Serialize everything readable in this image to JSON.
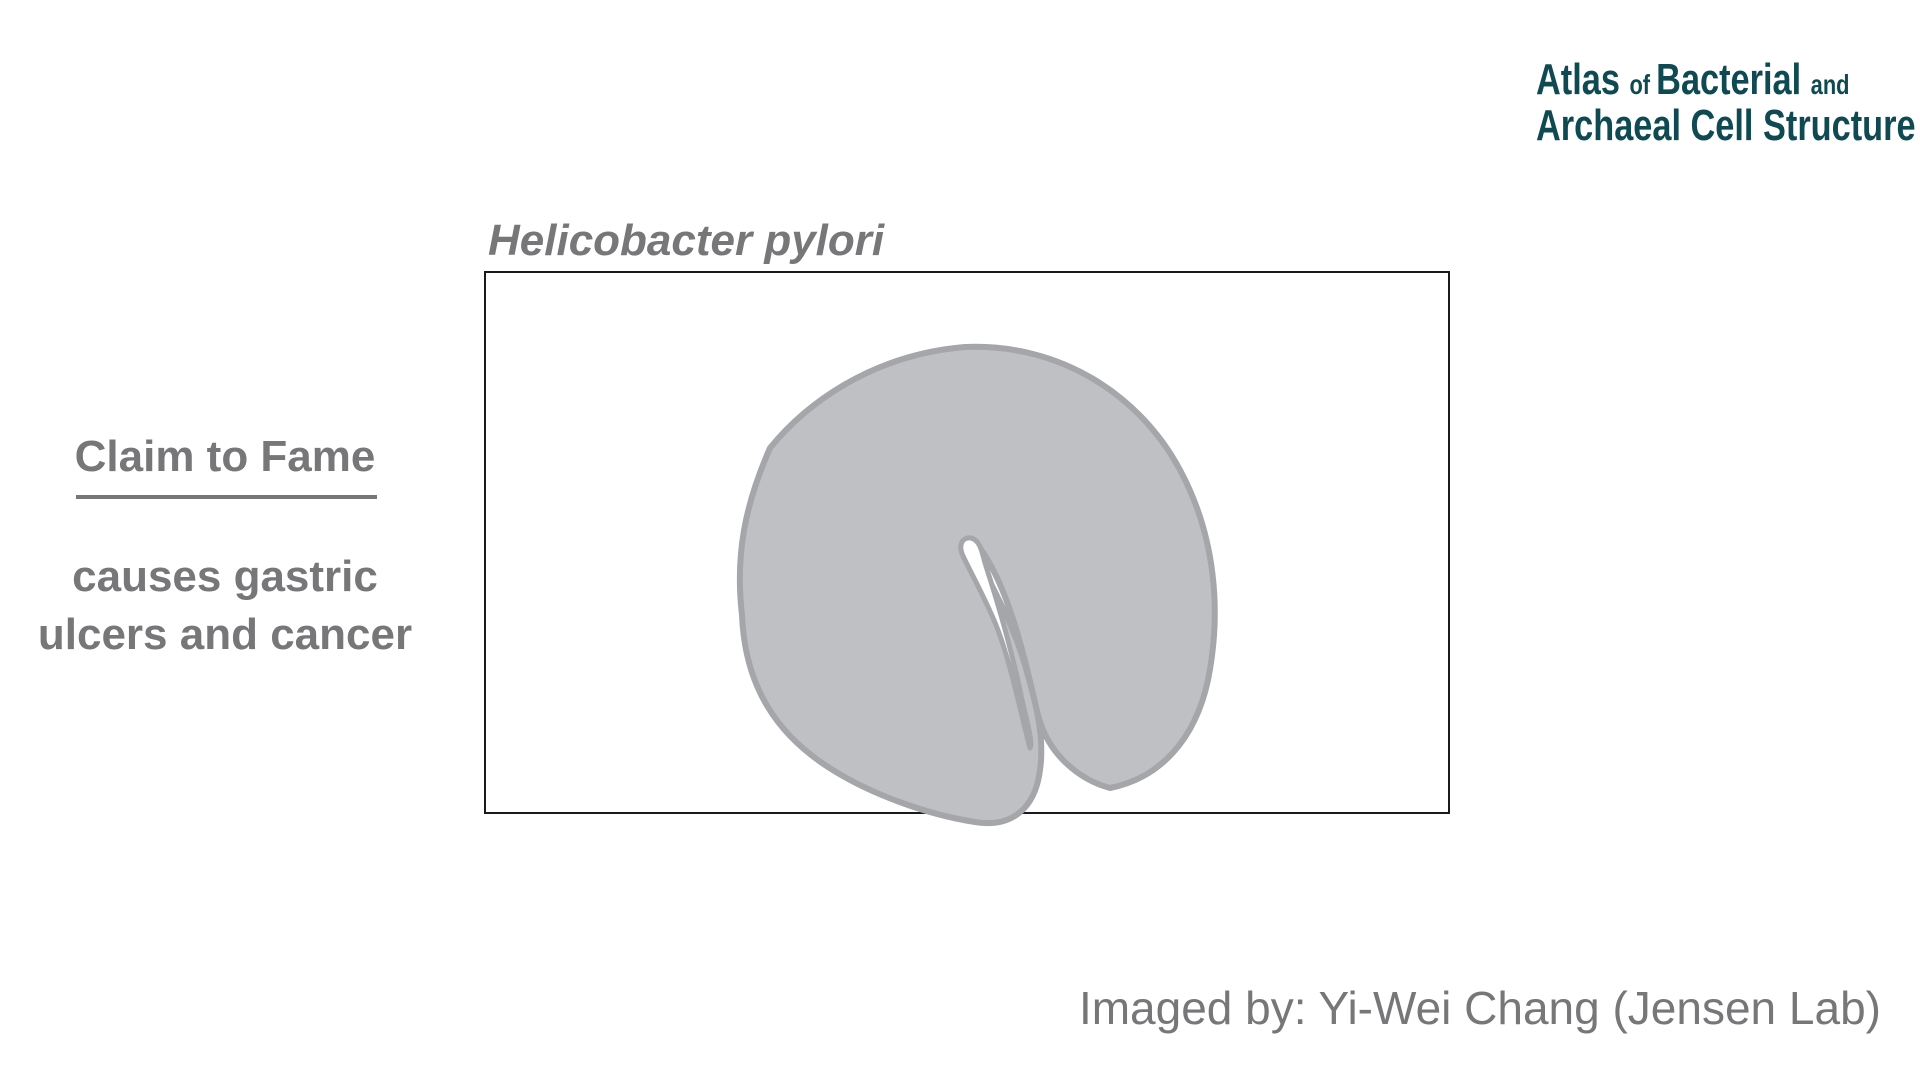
{
  "logo": {
    "line1": [
      {
        "text": "Atlas ",
        "size": "big"
      },
      {
        "text": "of ",
        "size": "small"
      },
      {
        "text": "Bacterial ",
        "size": "big"
      },
      {
        "text": "and",
        "size": "small"
      }
    ],
    "line2": "Archaeal Cell Structure",
    "color": "#0f4a52"
  },
  "species_name": "Helicobacter pylori",
  "claim": {
    "title": "Claim to Fame",
    "body_lines": [
      "causes gastric",
      "ulcers and cancer"
    ]
  },
  "credit": "Imaged by: Yi-Wei Chang (Jensen Lab)",
  "colors": {
    "text_gray": "#77777a",
    "cell_fill": "#bfc0c3",
    "cell_outline": "#a5a6a9",
    "frame": "#1a1a1a"
  }
}
